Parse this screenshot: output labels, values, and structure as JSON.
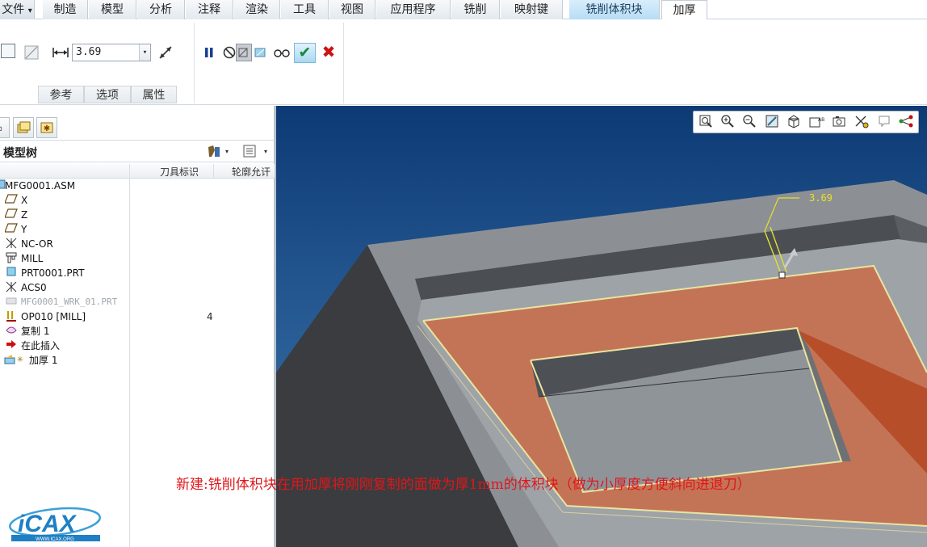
{
  "menubar": {
    "file": "文件",
    "file_arrow": "▾",
    "items": [
      "制造",
      "模型",
      "分析",
      "注释",
      "渲染",
      "工具",
      "视图",
      "应用程序",
      "铣削",
      "映射键"
    ],
    "context_tab": "铣削体积块",
    "active_tab": "加厚"
  },
  "ribbon": {
    "thickness_value": "3.69",
    "dropdown_arrow": "▾",
    "tabs": [
      "参考",
      "选项",
      "属性"
    ],
    "icons": {
      "surface": "square-icon",
      "slash": "slash-icon",
      "dimension": "horizontal-dimension-icon",
      "flip": "flip-direction-icon",
      "pause": "pause-icon",
      "no_preview": "no-preview-icon",
      "preview": "preview-icon",
      "verify": "glasses-icon",
      "confirm": "checkmark-icon",
      "cancel": "close-icon"
    }
  },
  "model_tree": {
    "title": "模型树",
    "columns": [
      "刀具标识",
      "轮廓允讦"
    ],
    "rows": [
      {
        "icon": "assembly-icon",
        "label": "MFG0001.ASM",
        "value": ""
      },
      {
        "icon": "datum-plane-icon",
        "label": "X",
        "value": ""
      },
      {
        "icon": "datum-plane-icon",
        "label": "Z",
        "value": ""
      },
      {
        "icon": "datum-plane-icon",
        "label": "Y",
        "value": ""
      },
      {
        "icon": "coordinate-system-icon",
        "label": "NC-OR",
        "value": ""
      },
      {
        "icon": "mill-icon",
        "label": "MILL",
        "value": ""
      },
      {
        "icon": "part-icon",
        "label": "PRT0001.PRT",
        "value": ""
      },
      {
        "icon": "coordinate-system-icon",
        "label": "ACS0",
        "value": ""
      },
      {
        "icon": "workpiece-icon",
        "label": "MFG0001_WRK_01.PRT",
        "value": "",
        "dim": true
      },
      {
        "icon": "operation-icon",
        "label": "OP010 [MILL]",
        "value": "4"
      },
      {
        "icon": "copy-icon",
        "label": "复制 1",
        "value": ""
      },
      {
        "icon": "insert-here-icon",
        "label": "在此插入",
        "value": ""
      },
      {
        "icon": "thicken-icon",
        "label": "加厚 1",
        "value": ""
      }
    ]
  },
  "viewport": {
    "dimension_label": "3.69",
    "caption": "新建:铣削体积块在用加厚将刚刚复制的面做为厚1mm的体积块（做为小厚度方便斜向进退刀）",
    "logo_text": "iCAX",
    "logo_url": "WWW.ICAX.ORG",
    "toolbar_icons": [
      "zoom-fit-icon",
      "zoom-in-icon",
      "zoom-out-icon",
      "repaint-icon",
      "display-style-icon",
      "saved-views-icon",
      "view-manager-icon",
      "datum-display-icon",
      "annotation-icon",
      "spin-center-icon"
    ]
  },
  "colors": {
    "viewport_top": "#0d3a74",
    "viewport_bottom": "#3f77ab",
    "part_grey": "#8d9196",
    "volume_orange": "#c8704f",
    "dimension_yellow": "#e6e02a",
    "caption_red": "#e0161a"
  }
}
